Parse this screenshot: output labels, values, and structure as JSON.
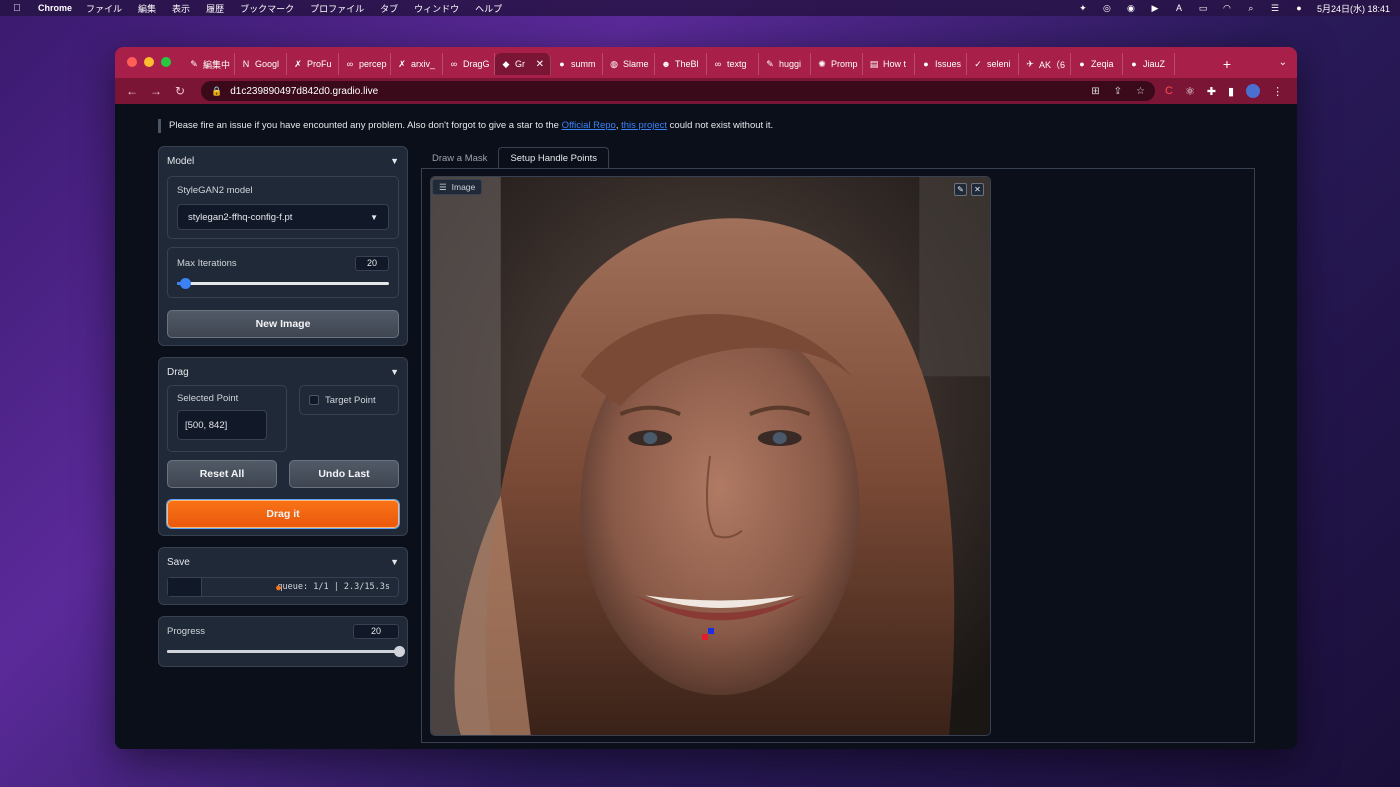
{
  "menubar": {
    "app_name": "Chrome",
    "menus": [
      "ファイル",
      "編集",
      "表示",
      "履歴",
      "ブックマーク",
      "プロファイル",
      "タブ",
      "ウィンドウ",
      "ヘルプ"
    ],
    "clock": "5月24日(水) 18:41"
  },
  "browser": {
    "tabs": [
      {
        "label": "編集中",
        "icon": "edit-icon"
      },
      {
        "label": "Googl",
        "icon": "notion-icon"
      },
      {
        "label": "ProFu",
        "icon": "arxiv-icon"
      },
      {
        "label": "percep",
        "icon": "infinity-icon"
      },
      {
        "label": "arxiv_",
        "icon": "arxiv-icon"
      },
      {
        "label": "DragG",
        "icon": "infinity-icon"
      },
      {
        "label": "Gr",
        "icon": "gradio-icon",
        "active": true
      },
      {
        "label": "summ",
        "icon": "github-icon"
      },
      {
        "label": "Slame",
        "icon": "globe-icon"
      },
      {
        "label": "TheBl",
        "icon": "huggingface-icon"
      },
      {
        "label": "textg",
        "icon": "infinity-icon"
      },
      {
        "label": "huggi",
        "icon": "edit-icon"
      },
      {
        "label": "Promp",
        "icon": "openai-icon"
      },
      {
        "label": "How t",
        "icon": "doc-icon"
      },
      {
        "label": "Issues",
        "icon": "github-icon"
      },
      {
        "label": "seleni",
        "icon": "selenium-icon"
      },
      {
        "label": "AK（6",
        "icon": "twitter-icon"
      },
      {
        "label": "Zeqia",
        "icon": "github-icon"
      },
      {
        "label": "JiauZ",
        "icon": "github-icon"
      }
    ],
    "url": "d1c239890497d842d0.gradio.live"
  },
  "notice": {
    "text_before": "Please fire an issue if you have encounted any problem. Also don't forgot to give a star to the ",
    "link1": "Official Repo",
    "text_mid": ", ",
    "link2": "this project",
    "text_after": " could not exist without it."
  },
  "model": {
    "title": "Model",
    "model_label": "StyleGAN2 model",
    "model_value": "stylegan2-ffhq-config-f.pt",
    "iter_label": "Max Iterations",
    "iter_value": "20",
    "iter_fraction": 0.04,
    "new_image_label": "New Image"
  },
  "drag": {
    "title": "Drag",
    "selected_label": "Selected Point",
    "selected_value": "[500, 842]",
    "target_label": "Target Point",
    "reset_label": "Reset All",
    "undo_label": "Undo Last",
    "drag_label": "Drag it"
  },
  "save": {
    "title": "Save",
    "queue_text": "queue: 1/1 | 2.3/15.3s"
  },
  "progress": {
    "label": "Progress",
    "value": "20",
    "fraction": 1.0
  },
  "main": {
    "tab1": "Draw a Mask",
    "tab2": "Setup Handle Points",
    "image_label": "Image"
  },
  "colors": {
    "accent": "#f97316",
    "slider": "#3b82f6",
    "handle_red": "#e11d2a",
    "handle_blue": "#1d2ee1"
  }
}
